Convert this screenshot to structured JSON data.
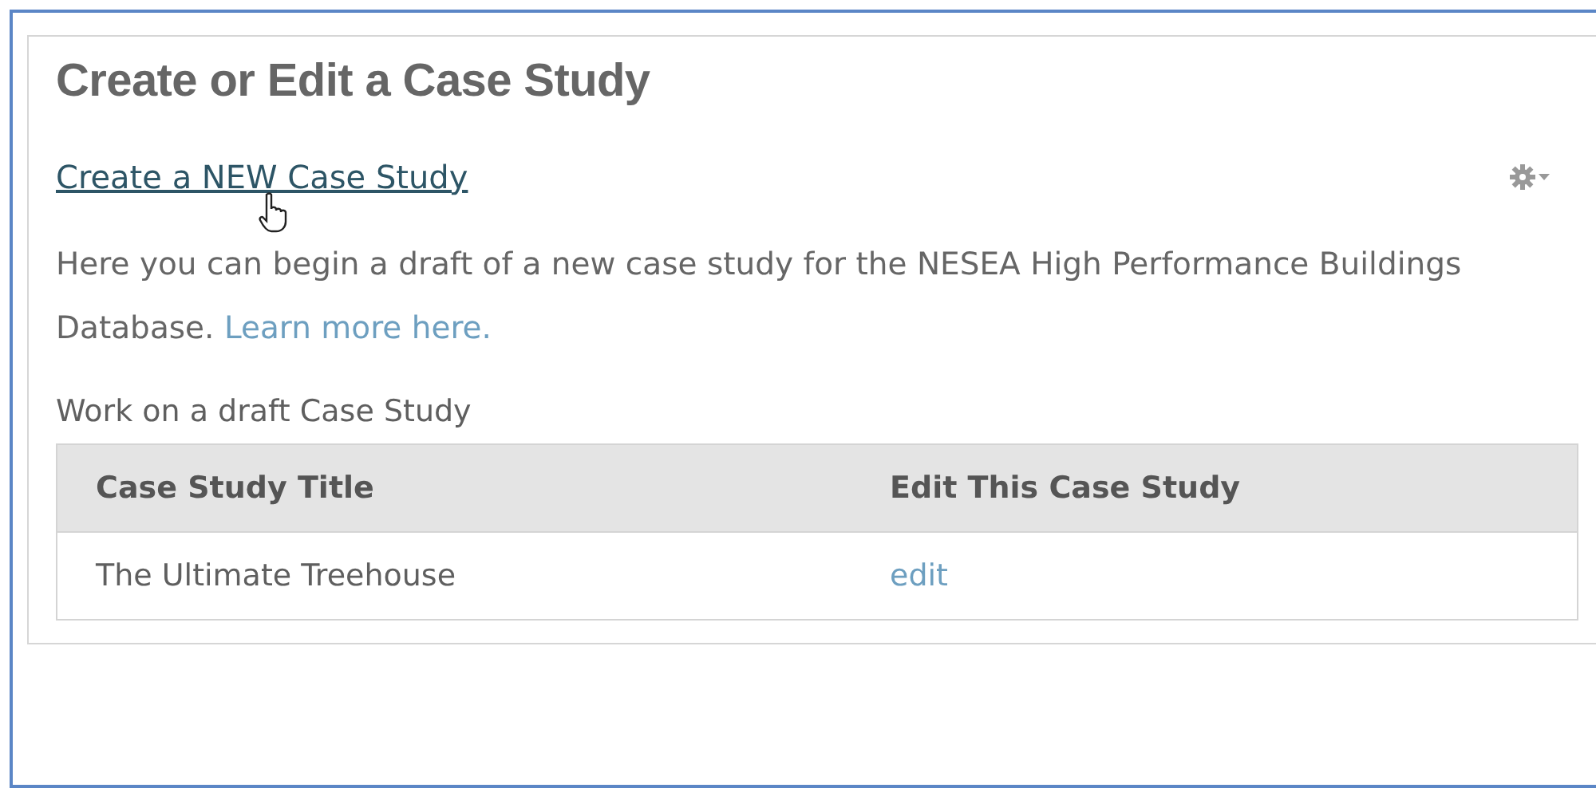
{
  "panel": {
    "title": "Create or Edit a Case Study",
    "create_link": "Create a NEW Case Study",
    "description": "Here you can begin a draft of a new case study for the NESEA High Performance Buildings Database.",
    "learn_more_link": "Learn more here.",
    "drafts_label": "Work on a draft Case Study"
  },
  "table": {
    "columns": [
      "Case Study Title",
      "Edit This Case Study"
    ],
    "rows": [
      {
        "title": "The Ultimate Treehouse",
        "action": "edit"
      }
    ]
  }
}
